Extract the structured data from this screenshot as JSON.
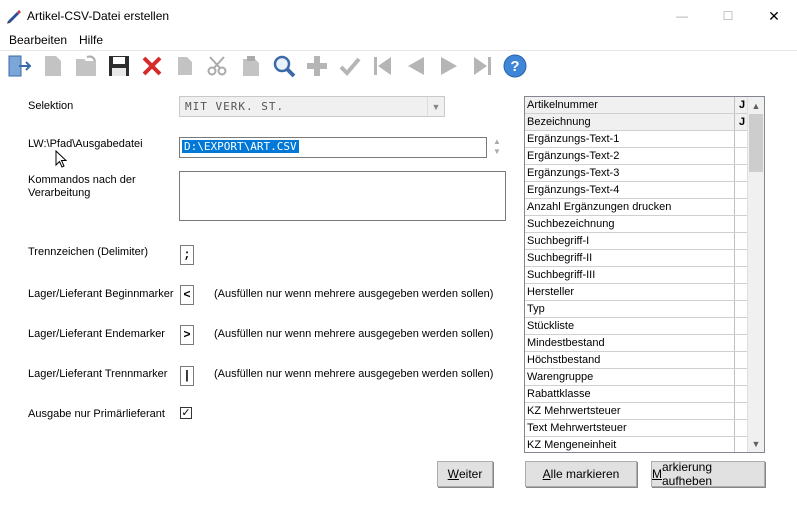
{
  "window": {
    "title": "Artikel-CSV-Datei erstellen",
    "minimize_glyph": "—",
    "maximize_glyph": "☐",
    "close_glyph": "✕"
  },
  "menu": [
    "Bearbeiten",
    "Hilfe"
  ],
  "toolbar_icons": [
    "exit-icon",
    "new-document-icon",
    "open-document-icon",
    "save-icon",
    "delete-icon",
    "copy-icon",
    "cut-icon",
    "paste-icon",
    "search-icon",
    "add-icon",
    "confirm-icon",
    "first-record-icon",
    "previous-record-icon",
    "next-record-icon",
    "last-record-icon",
    "help-icon"
  ],
  "form": {
    "selektion_label": "Selektion",
    "selektion_value": "MIT VERK. ST.",
    "path_label": "LW:\\Pfad\\Ausgabedatei",
    "path_value": "D:\\EXPORT\\ART.CSV",
    "commands_label": "Kommandos nach der Verarbeitung",
    "commands_value": "",
    "delimiter_label": "Trennzeichen (Delimiter)",
    "delimiter_value": ";",
    "begin_marker_label": "Lager/Lieferant Beginnmarker",
    "begin_marker_value": "<",
    "end_marker_label": "Lager/Lieferant Endemarker",
    "end_marker_value": ">",
    "sep_marker_label": "Lager/Lieferant Trennmarker",
    "sep_marker_value": "|",
    "marker_hint": "(Ausfüllen nur wenn mehrere ausgegeben werden sollen)",
    "primary_supplier_label": "Ausgabe nur Primärlieferant",
    "primary_supplier_checked": true,
    "check_glyph": "✓"
  },
  "fields": [
    {
      "name": "Artikelnummer",
      "flag": "J"
    },
    {
      "name": "Bezeichnung",
      "flag": "J"
    },
    {
      "name": "Ergänzungs-Text-1",
      "flag": ""
    },
    {
      "name": "Ergänzungs-Text-2",
      "flag": ""
    },
    {
      "name": "Ergänzungs-Text-3",
      "flag": ""
    },
    {
      "name": "Ergänzungs-Text-4",
      "flag": ""
    },
    {
      "name": "Anzahl Ergänzungen drucken",
      "flag": ""
    },
    {
      "name": "Suchbezeichnung",
      "flag": ""
    },
    {
      "name": "Suchbegriff-I",
      "flag": ""
    },
    {
      "name": "Suchbegriff-II",
      "flag": ""
    },
    {
      "name": "Suchbegriff-III",
      "flag": ""
    },
    {
      "name": "Hersteller",
      "flag": ""
    },
    {
      "name": "Typ",
      "flag": ""
    },
    {
      "name": "Stückliste",
      "flag": ""
    },
    {
      "name": "Mindestbestand",
      "flag": ""
    },
    {
      "name": "Höchstbestand",
      "flag": ""
    },
    {
      "name": "Warengruppe",
      "flag": ""
    },
    {
      "name": "Rabattklasse",
      "flag": ""
    },
    {
      "name": "KZ Mehrwertsteuer",
      "flag": ""
    },
    {
      "name": "Text Mehrwertsteuer",
      "flag": ""
    },
    {
      "name": "KZ Mengeneinheit",
      "flag": ""
    }
  ],
  "buttons": {
    "weiter": "Weiter",
    "alle_markieren": "Alle markieren",
    "markierung_aufheben": "Markierung aufheben"
  }
}
